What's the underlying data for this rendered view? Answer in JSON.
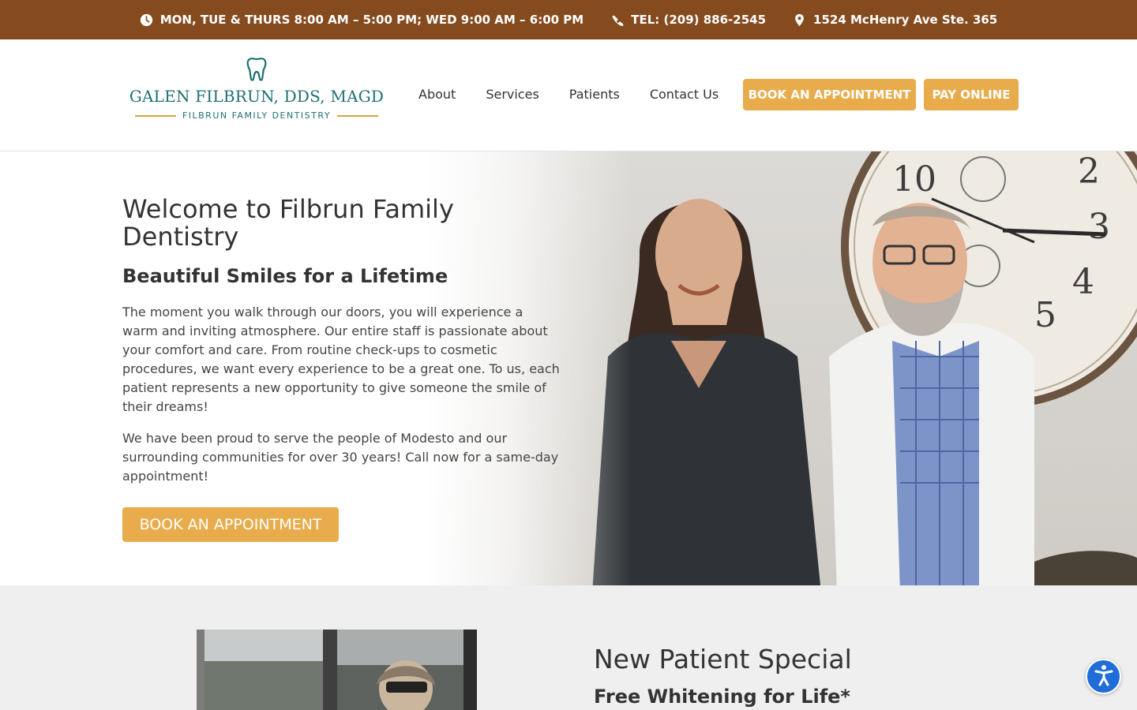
{
  "topbar": {
    "hours": "MON, TUE & THURS 8:00 AM – 5:00 PM; WED 9:00 AM – 6:00 PM",
    "phone": "TEL: (209) 886-2545",
    "address": "1524 McHenry Ave Ste. 365",
    "background": "#854b1f"
  },
  "logo": {
    "name": "GALEN FILBRUN, DDS, MAGD",
    "tagline": "FILBRUN FAMILY DENTISTRY",
    "icon": "tooth-icon"
  },
  "nav": {
    "items": [
      "About",
      "Services",
      "Patients",
      "Contact Us"
    ]
  },
  "header_buttons": {
    "book": "BOOK AN APPOINTMENT",
    "pay": "PAY ONLINE",
    "color": "#e9ac4c"
  },
  "hero": {
    "title": "Welcome to Filbrun Family Dentistry",
    "subtitle": "Beautiful Smiles for a Lifetime",
    "paragraph1": "The moment you walk through our doors, you will experience a warm and inviting atmosphere. Our entire staff is passionate about your comfort and care. From routine check-ups to cosmetic procedures, we want every experience to be a great one. To us, each patient represents a new opportunity to give someone the smile of their dreams!",
    "paragraph2": "We have been proud to serve the people of Modesto and our surrounding communities for over 30 years! Call now for a same-day appointment!",
    "button": "BOOK AN APPOINTMENT"
  },
  "special": {
    "title": "New Patient Special",
    "subtitle": "Free Whitening for Life*"
  },
  "accessibility": {
    "icon": "accessibility-icon",
    "color": "#1f6dd8"
  }
}
